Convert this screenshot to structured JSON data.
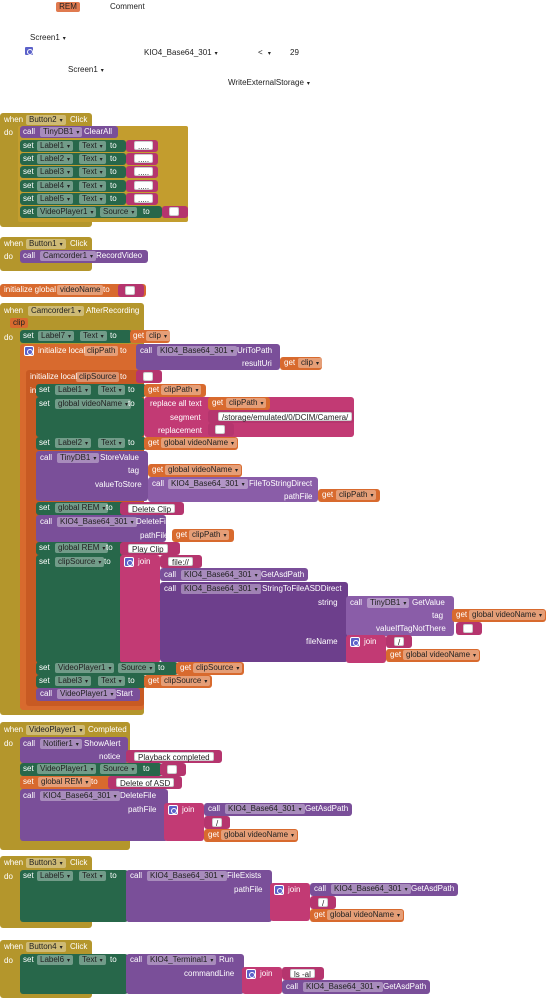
{
  "header": {
    "rem_badge": "REM",
    "comment_label": "Comment",
    "screen1_top": "Screen1",
    "component_value": "KIO4_Base64_301",
    "compare_op": "< ",
    "number_value": "29",
    "screen1_bottom": "Screen1",
    "permission_value": "WriteExternalStorage"
  },
  "ui_words": {
    "when": "when",
    "do": "do",
    "call": "call",
    "set": "set",
    "to": "to",
    "get": "get",
    "in": "in",
    "join": "join",
    "click": "Click",
    "text": "Text",
    "source": "Source",
    "initialize_global": "initialize global",
    "initialize_local": "initialize local",
    "dots": "....."
  },
  "events": {
    "button2": {
      "component": "Button2",
      "tinydb": "TinyDB1",
      "tinydb_method": "ClearAll",
      "labels": [
        "Label1",
        "Label2",
        "Label3",
        "Label4",
        "Label5"
      ],
      "videoplayer": "VideoPlayer1"
    },
    "button1": {
      "component": "Button1",
      "camcorder": "Camcorder1",
      "method": "RecordVideo"
    },
    "global_var": {
      "name": "videoName"
    },
    "camcorder": {
      "component": "Camcorder1",
      "event": "AfterRecording",
      "param": "clip",
      "label7": "Label7",
      "local_cliPath": "clipPath",
      "kio": "KIO4_Base64_301",
      "uri_method": "UriToPath",
      "result_uri": "resultUri",
      "local_clipSource": "clipSource",
      "label1": "Label1",
      "global_videoName": "global videoName",
      "replace_all_text": "replace all text",
      "segment": "segment",
      "segment_value": "/storage/emulated/0/DCIM/Camera/",
      "replacement": "replacement",
      "label2": "Label2",
      "store_value": "StoreValue",
      "tag": "tag",
      "value_to_store": "valueToStore",
      "file_to_string": "FileToStringDirect",
      "path_file": "pathFile",
      "global_rem": "global REM",
      "delete_clip": "Delete Clip",
      "delete_file": "DeleteFile",
      "play_clip": "Play Clip",
      "file_prefix": "file://",
      "get_asd_path": "GetAsdPath",
      "string_to_file": "StringToFileASDDirect",
      "string": "string",
      "get_value": "GetValue",
      "value_if_not": "valueIfTagNotThere",
      "file_name": "fileName",
      "slash": "/",
      "videoplayer": "VideoPlayer1",
      "label3": "Label3",
      "start": "Start"
    },
    "completed": {
      "component": "VideoPlayer1",
      "event": "Completed",
      "notifier": "Notifier1",
      "show_alert": "ShowAlert",
      "notice": "notice",
      "playback_completed": "Playback completed",
      "delete_of_asd": "Delete of ASD"
    },
    "button3": {
      "component": "Button3",
      "label5": "Label5",
      "file_exists": "FileExists"
    },
    "button4": {
      "component": "Button4",
      "label6": "Label6",
      "terminal": "KIO4_Terminal1",
      "run": "Run",
      "command_line": "commandLine",
      "ls_al": "ls -al"
    }
  },
  "colors": {
    "event": "#b4962c",
    "set": "#27674a",
    "call": "#7a4f99",
    "variable": "#d86a2e",
    "text": "#b5356e",
    "mutator": "#5b61c9",
    "rem_badge": "#e07a4f"
  }
}
